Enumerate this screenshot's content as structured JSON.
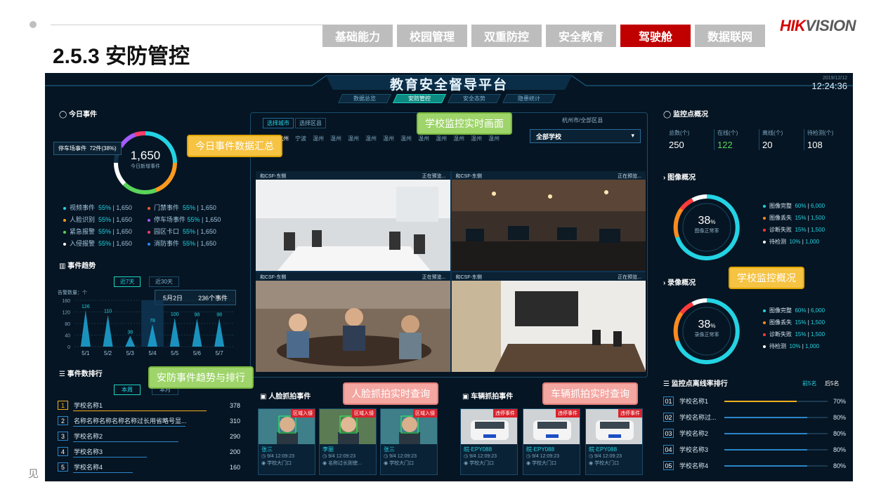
{
  "slide": {
    "title": "2.5.3 安防管控",
    "footnote": "见"
  },
  "brand": {
    "logo_red": "HIK",
    "logo_gray": "VISION"
  },
  "nav_tabs": [
    {
      "label": "基础能力",
      "active": false
    },
    {
      "label": "校园管理",
      "active": false
    },
    {
      "label": "双重防控",
      "active": false
    },
    {
      "label": "安全教育",
      "active": false
    },
    {
      "label": "驾驶舱",
      "active": true
    },
    {
      "label": "数据联网",
      "active": false
    }
  ],
  "dashboard": {
    "title": "教育安全督导平台",
    "date": "2019/12/12",
    "time": "12:24:36",
    "sub_tabs": [
      {
        "label": "数据总览",
        "active": false
      },
      {
        "label": "安防管控",
        "active": true
      },
      {
        "label": "安全态势",
        "active": false
      },
      {
        "label": "隐患统计",
        "active": false
      }
    ]
  },
  "today_events": {
    "heading": "今日事件",
    "total": "1,650",
    "total_label": "今日新增事件",
    "tooltip_label": "停车场事件",
    "tooltip_value": "72件(38%)",
    "items": [
      {
        "name": "视频事件",
        "pct": "55%",
        "count": "1,650",
        "color": "#23d3e3"
      },
      {
        "name": "门禁事件",
        "pct": "55%",
        "count": "1,650",
        "color": "#ff5a2a"
      },
      {
        "name": "人脸识别",
        "pct": "55%",
        "count": "1,650",
        "color": "#ff9a1e"
      },
      {
        "name": "停车场事件",
        "pct": "55%",
        "count": "1,650",
        "color": "#a45bff"
      },
      {
        "name": "紧急报警",
        "pct": "55%",
        "count": "1,650",
        "color": "#5ad45a"
      },
      {
        "name": "园区卡口",
        "pct": "55%",
        "count": "1,650",
        "color": "#ff3b6b"
      },
      {
        "name": "入侵报警",
        "pct": "55%",
        "count": "1,650",
        "color": "#ffffff"
      },
      {
        "name": "消防事件",
        "pct": "55%",
        "count": "1,650",
        "color": "#2a86ff"
      }
    ]
  },
  "trend": {
    "heading": "事件趋势",
    "btn_7": "近7天",
    "btn_30": "近30天",
    "ylabel": "告警数量：个",
    "tooltip_date": "5月2日",
    "tooltip_value": "236个事件",
    "yticks": [
      "160",
      "120",
      "80",
      "40",
      "0"
    ]
  },
  "chart_data": {
    "type": "bar",
    "categories": [
      "5/1",
      "5/2",
      "5/3",
      "5/4",
      "5/5",
      "5/6",
      "5/7"
    ],
    "values": [
      126,
      110,
      38,
      78,
      100,
      98,
      98
    ],
    "ylim": [
      0,
      160
    ]
  },
  "ranking": {
    "heading": "事件数排行",
    "tab_week": "本周",
    "tab_month": "本月",
    "rows": [
      {
        "rank": "1",
        "name": "学校名称1",
        "value": "378"
      },
      {
        "rank": "2",
        "name": "名称名称名称名称名称过长用省略号显...",
        "value": "310"
      },
      {
        "rank": "3",
        "name": "学校名称2",
        "value": "290"
      },
      {
        "rank": "4",
        "name": "学校名称3",
        "value": "200"
      },
      {
        "rank": "5",
        "name": "学校名称4",
        "value": "160"
      }
    ]
  },
  "video": {
    "select_city": "选择城市",
    "select_area": "选择区县",
    "region": "杭州市/全部区县",
    "school_select": "全部学校",
    "cities": [
      "全部",
      "杭州",
      "宁波",
      "温州",
      "温州",
      "温州",
      "温州",
      "温州",
      "温州",
      "温州",
      "温州",
      "温州",
      "温州",
      "温州",
      "温州"
    ],
    "cams": [
      {
        "name": "和CSF-东侧",
        "status": "正在预览..."
      },
      {
        "name": "和CSF-东侧",
        "status": "正在预览..."
      },
      {
        "name": "和CSF-东侧",
        "status": "正在预览..."
      },
      {
        "name": "和CSF-东侧",
        "status": "正在预览..."
      }
    ]
  },
  "face_capture": {
    "heading": "人脸抓拍事件",
    "cards": [
      {
        "tag": "区域入侵",
        "name": "张三",
        "time": "9/4  12:09:23",
        "place": "学校大门口"
      },
      {
        "tag": "区域入侵",
        "name": "李丽",
        "time": "9/4  12:09:23",
        "place": "名称过长则使..."
      },
      {
        "tag": "区域入侵",
        "name": "张三",
        "time": "9/4  12:09:23",
        "place": "学校大门口"
      }
    ]
  },
  "car_capture": {
    "heading": "车辆抓拍事件",
    "cards": [
      {
        "tag": "违停事件",
        "name": "皖·EPY088",
        "time": "9/4  12:09:23",
        "place": "学校大门口"
      },
      {
        "tag": "违停事件",
        "name": "皖·EPY088",
        "time": "9/4  12:09:23",
        "place": "学校大门口"
      },
      {
        "tag": "违停事件",
        "name": "皖·EPY088",
        "time": "9/4  12:09:23",
        "place": "学校大门口"
      }
    ]
  },
  "monitor": {
    "heading": "监控点概况",
    "stats": [
      {
        "label": "总数(个)",
        "value": "250",
        "color": "#23d3e3"
      },
      {
        "label": "在线(个)",
        "value": "122",
        "color": "#5ad45a"
      },
      {
        "label": "离线(个)",
        "value": "20",
        "color": "#ff8a1e"
      },
      {
        "label": "待检测(个)",
        "value": "108",
        "color": "#ffffff"
      }
    ],
    "image_heading": "图像概况",
    "image_pct": "38",
    "image_pct_unit": "%",
    "image_label": "图像正常率",
    "record_heading": "录像概况",
    "record_pct": "38",
    "record_pct_unit": "%",
    "record_label": "录像正常率",
    "legend": [
      {
        "name": "图像完整",
        "pct": "60%",
        "count": "6,000",
        "color": "#23d3e3"
      },
      {
        "name": "图像丢失",
        "pct": "15%",
        "count": "1,500",
        "color": "#ff8a1e"
      },
      {
        "name": "诊断失败",
        "pct": "15%",
        "count": "1,500",
        "color": "#ff3b3b"
      },
      {
        "name": "待检测",
        "pct": "10%",
        "count": "1,000",
        "color": "#ffffff"
      }
    ],
    "legend2": [
      {
        "name": "图像完整",
        "pct": "60%",
        "count": "6,000",
        "color": "#23d3e3"
      },
      {
        "name": "图像丢失",
        "pct": "15%",
        "count": "1,500",
        "color": "#ff8a1e"
      },
      {
        "name": "诊断失败",
        "pct": "15%",
        "count": "1,500",
        "color": "#ff3b3b"
      },
      {
        "name": "待检测",
        "pct": "10%",
        "count": "1,000",
        "color": "#ffffff"
      }
    ]
  },
  "offline": {
    "heading": "监控点离线率排行",
    "tab_top5": "前5名",
    "tab_bottom5": "后5名",
    "rows": [
      {
        "rank": "01",
        "name": "学校名称1",
        "value": "70%",
        "fill": 0.7
      },
      {
        "rank": "02",
        "name": "学校名称过...",
        "value": "80%",
        "fill": 0.8
      },
      {
        "rank": "03",
        "name": "学校名称2",
        "value": "80%",
        "fill": 0.8
      },
      {
        "rank": "04",
        "name": "学校名称3",
        "value": "80%",
        "fill": 0.8
      },
      {
        "rank": "05",
        "name": "学校名称4",
        "value": "80%",
        "fill": 0.8
      }
    ]
  },
  "callouts": {
    "today": "今日事件数据汇总",
    "video": "学校监控实时画面",
    "monitor": "学校监控概况",
    "trend": "安防事件趋势与排行",
    "face": "人脸抓拍实时查询",
    "car": "车辆抓拍实时查询"
  }
}
